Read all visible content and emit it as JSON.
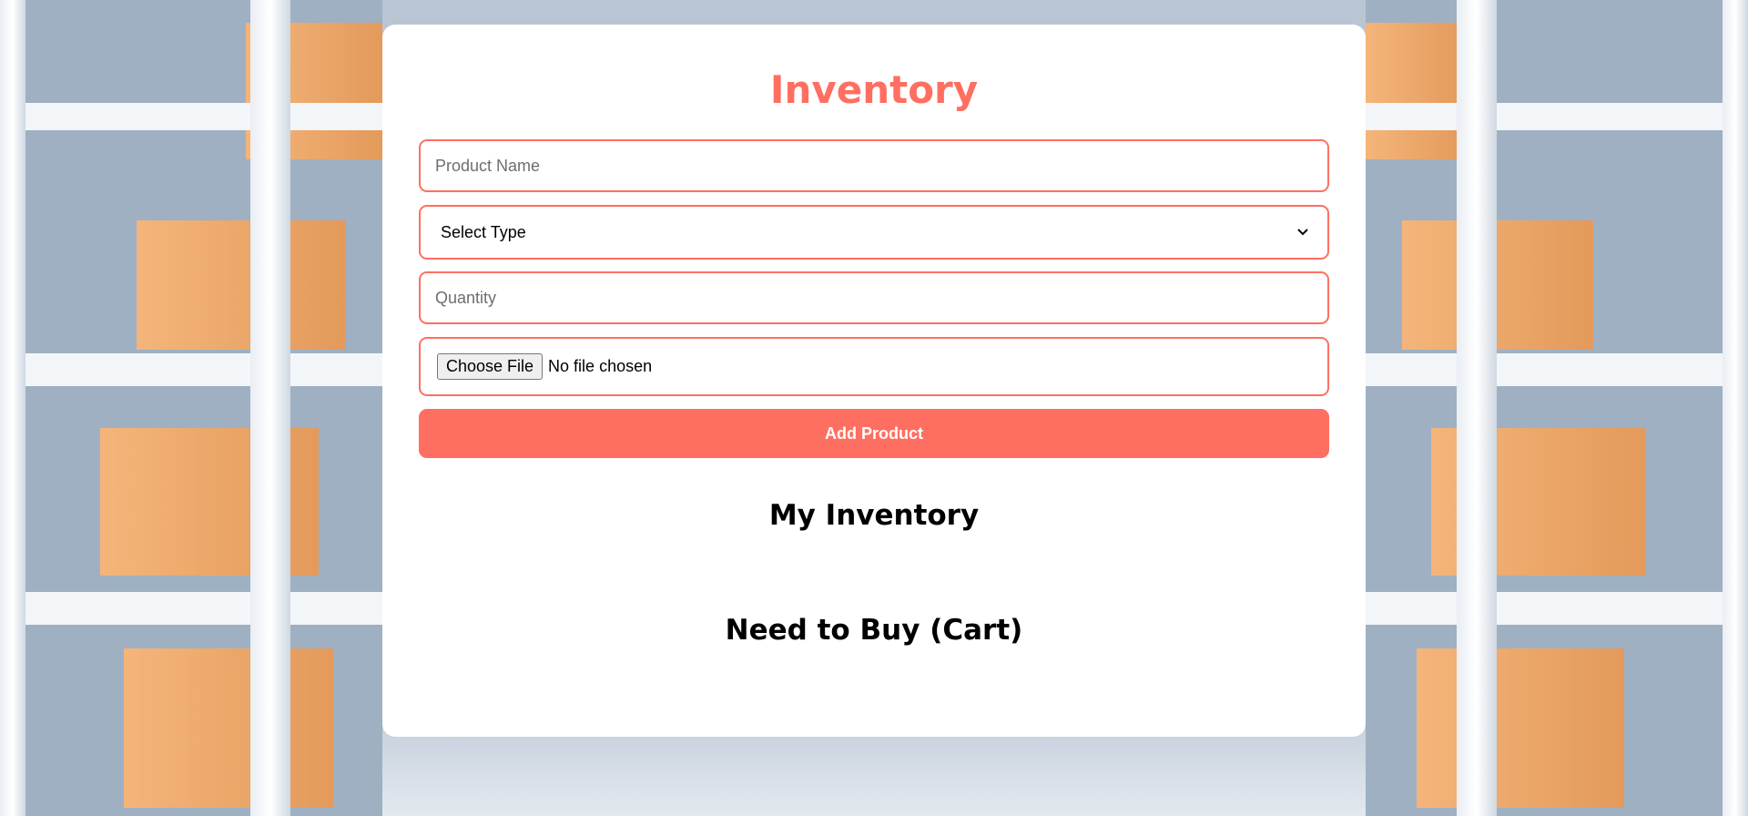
{
  "page": {
    "title": "Inventory"
  },
  "form": {
    "product_name_placeholder": "Product Name",
    "select_type_label": "Select Type",
    "quantity_placeholder": "Quantity",
    "file_button_label": "Choose File",
    "file_status": "No file chosen",
    "add_button_label": "Add Product"
  },
  "sections": {
    "inventory_heading": "My Inventory",
    "cart_heading": "Need to Buy (Cart)"
  },
  "colors": {
    "accent": "#ff6f61",
    "card_background": "#ffffff",
    "box_color": "#f2a96b"
  },
  "icons": {
    "select_chevron": "chevron-down-icon"
  }
}
